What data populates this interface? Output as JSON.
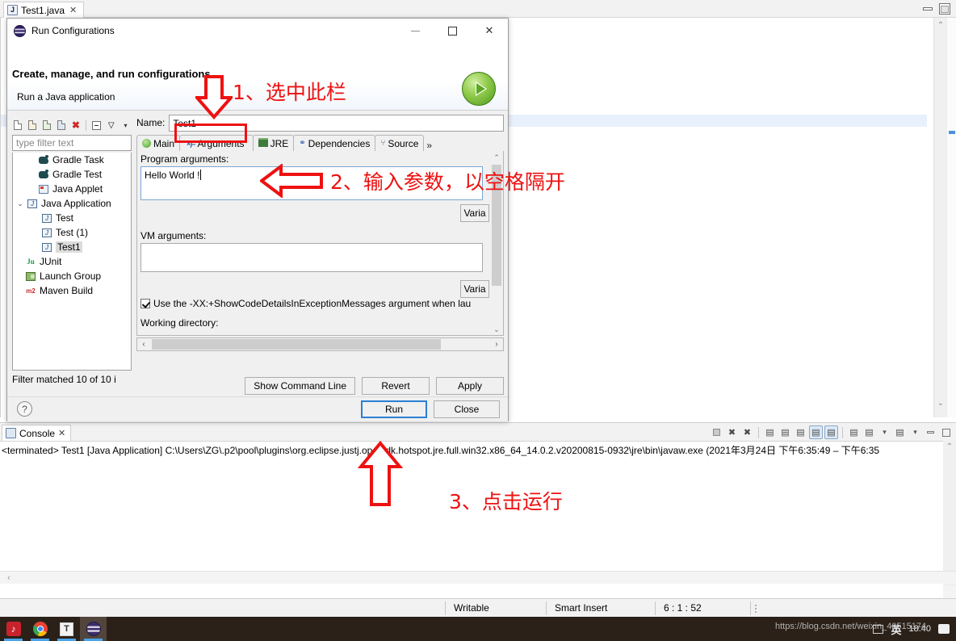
{
  "ide": {
    "editor_tab": {
      "label": "Test1.java",
      "close": "✕",
      "icon": "java-file-icon"
    },
    "window_controls": {
      "minimize": "minimize-icon",
      "maximize": "maximize-icon"
    }
  },
  "dialog": {
    "title": "Run Configurations",
    "window_buttons": {
      "minimize": "–",
      "maximize": "□",
      "close": "✕"
    },
    "heading": "Create, manage, and run configurations",
    "subheading": "Run a Java application",
    "tree_toolbar": [
      {
        "name": "new-configuration-icon",
        "glyph": ""
      },
      {
        "name": "new-prototype-icon",
        "glyph": ""
      },
      {
        "name": "export-icon",
        "glyph": ""
      },
      {
        "name": "duplicate-icon",
        "glyph": ""
      },
      {
        "name": "delete-icon",
        "glyph": "✖"
      },
      {
        "name": "collapse-all-icon",
        "glyph": ""
      },
      {
        "name": "filter-icon",
        "glyph": ""
      },
      {
        "name": "view-menu-caret-icon",
        "glyph": "▾"
      }
    ],
    "filter": {
      "placeholder": "type filter text",
      "value": "type filter text"
    },
    "tree": [
      {
        "label": "Gradle Task",
        "icon": "gradle-icon",
        "indent": 1,
        "twisty": "",
        "selected": false
      },
      {
        "label": "Gradle Test",
        "icon": "gradle-icon",
        "indent": 1,
        "twisty": "",
        "selected": false
      },
      {
        "label": "Java Applet",
        "icon": "java-applet-icon",
        "indent": 1,
        "twisty": "",
        "selected": false
      },
      {
        "label": "Java Application",
        "icon": "java-application-icon",
        "indent": 0,
        "twisty": "⌄",
        "selected": false
      },
      {
        "label": "Test",
        "icon": "java-config-icon",
        "indent": 2,
        "twisty": "",
        "selected": false
      },
      {
        "label": "Test (1)",
        "icon": "java-config-icon",
        "indent": 2,
        "twisty": "",
        "selected": false
      },
      {
        "label": "Test1",
        "icon": "java-config-icon",
        "indent": 2,
        "twisty": "",
        "selected": true
      },
      {
        "label": "JUnit",
        "icon": "junit-icon",
        "indent": 1,
        "twisty": "",
        "selected": false
      },
      {
        "label": "Launch Group",
        "icon": "launch-group-icon",
        "indent": 1,
        "twisty": "",
        "selected": false
      },
      {
        "label": "Maven Build",
        "icon": "maven-icon",
        "indent": 1,
        "twisty": "",
        "selected": false
      }
    ],
    "filter_status": "Filter matched 10 of 10 i",
    "name_label": "Name:",
    "name_value": "Test1",
    "tabs": [
      {
        "label": "Main",
        "icon": "main-tab-icon",
        "active": false
      },
      {
        "label": "Arguments",
        "icon": "arguments-tab-icon",
        "active": true
      },
      {
        "label": "JRE",
        "icon": "jre-tab-icon",
        "active": false
      },
      {
        "label": "Dependencies",
        "icon": "dependencies-tab-icon",
        "active": false
      },
      {
        "label": "Source",
        "icon": "source-tab-icon",
        "active": false
      }
    ],
    "tabs_overflow": "»",
    "program_arguments_label": "Program arguments:",
    "program_arguments_value": "Hello World !",
    "vm_arguments_label": "VM arguments:",
    "vm_arguments_value": "",
    "variables_button_1": "Varia",
    "variables_button_2": "Varia",
    "show_code_details_checkbox": {
      "checked": true,
      "label": "Use the -XX:+ShowCodeDetailsInExceptionMessages argument when lau"
    },
    "working_directory_label": "Working directory:",
    "buttons": {
      "show_command_line": "Show Command Line",
      "revert": "Revert",
      "apply": "Apply",
      "run": "Run",
      "close": "Close",
      "help": "?"
    }
  },
  "console": {
    "tab_label": "Console",
    "tab_close": "✕",
    "output_line": "<terminated> Test1 [Java Application] C:\\Users\\ZG\\.p2\\pool\\plugins\\org.eclipse.justj.openjdk.hotspot.jre.full.win32.x86_64_14.0.2.v20200815-0932\\jre\\bin\\javaw.exe  (2021年3月24日 下午6:35:49 – 下午6:35",
    "toolbar": [
      {
        "name": "terminate-icon",
        "glyph": "■",
        "active": false
      },
      {
        "name": "remove-launch-icon",
        "glyph": "✖",
        "active": false
      },
      {
        "name": "remove-all-launches-icon",
        "glyph": "✖",
        "active": false
      },
      {
        "name": "clear-console-icon",
        "glyph": "",
        "active": false
      },
      {
        "name": "scroll-lock-icon",
        "glyph": "",
        "active": false
      },
      {
        "name": "word-wrap-icon",
        "glyph": "",
        "active": false
      },
      {
        "name": "show-console-on-output-icon",
        "glyph": "",
        "active": true
      },
      {
        "name": "pin-console-icon",
        "glyph": "",
        "active": true
      },
      {
        "name": "open-console-icon",
        "glyph": "",
        "active": false
      },
      {
        "name": "display-selected-console-icon",
        "glyph": "",
        "active": false
      },
      {
        "name": "display-console-caret-icon",
        "glyph": "▾",
        "active": false
      },
      {
        "name": "new-console-view-icon",
        "glyph": "",
        "active": false
      },
      {
        "name": "new-console-caret-icon",
        "glyph": "▾",
        "active": false
      },
      {
        "name": "minimize-view-icon",
        "glyph": "—",
        "active": false
      },
      {
        "name": "maximize-view-icon",
        "glyph": "□",
        "active": false
      }
    ]
  },
  "statusbar": {
    "writable": "Writable",
    "insert_mode": "Smart Insert",
    "position": "6 : 1 : 52"
  },
  "taskbar": {
    "apps": [
      {
        "name": "netease-music-icon",
        "glyph": "♪",
        "active": false
      },
      {
        "name": "chrome-icon",
        "glyph": "",
        "active": false
      },
      {
        "name": "typora-icon",
        "glyph": "T",
        "active": false
      },
      {
        "name": "eclipse-icon",
        "glyph": "",
        "active": true
      }
    ],
    "tray": {
      "ime": "英",
      "clock_time": "18:40",
      "screen_icon": "display-icon",
      "notification_icon": "notification-icon"
    },
    "watermark": "https://blog.csdn.net/weixin_40515174"
  },
  "annotations": [
    {
      "id": 1,
      "text": "1、选中此栏",
      "arrow": "down-arrow"
    },
    {
      "id": 2,
      "text": "2、输入参数，以空格隔开",
      "arrow": "left-arrow"
    },
    {
      "id": 3,
      "text": "3、点击运行",
      "arrow": "up-arrow"
    }
  ],
  "colors": {
    "annotation_red": "#ee1111",
    "accent_blue": "#2b7fd4",
    "run_green": "#4e9a1e",
    "selection_gray": "#dcdcdc"
  }
}
